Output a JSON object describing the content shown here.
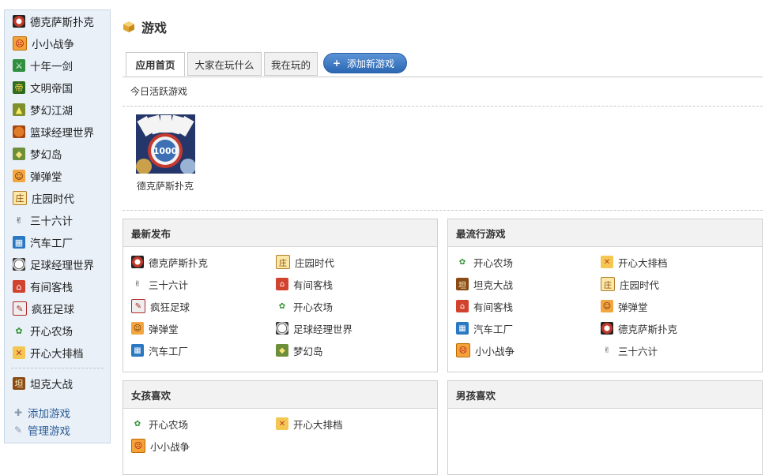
{
  "header": {
    "title": "游戏"
  },
  "sidebar": {
    "items": [
      {
        "label": "德克萨斯扑克",
        "icon": "poker-chip-icon",
        "cls": "i-poker",
        "glyph": ""
      },
      {
        "label": "小小战争",
        "icon": "little-war-icon",
        "cls": "i-war",
        "glyph": "☹"
      },
      {
        "label": "十年一剑",
        "icon": "sword-icon",
        "cls": "i-sword",
        "glyph": "⚔"
      },
      {
        "label": "文明帝国",
        "icon": "empire-icon",
        "cls": "i-empire",
        "glyph": "帝"
      },
      {
        "label": "梦幻江湖",
        "icon": "dream-jianghu-icon",
        "cls": "i-dream",
        "glyph": "▲"
      },
      {
        "label": "篮球经理世界",
        "icon": "basketball-icon",
        "cls": "i-basket",
        "glyph": ""
      },
      {
        "label": "梦幻岛",
        "icon": "island-icon",
        "cls": "i-island",
        "glyph": "◆"
      },
      {
        "label": "弹弹堂",
        "icon": "bomb-face-icon",
        "cls": "i-bomb",
        "glyph": "☺"
      },
      {
        "label": "庄园时代",
        "icon": "farmhouse-icon",
        "cls": "i-farmhouse",
        "glyph": "庄"
      },
      {
        "label": "三十六计",
        "icon": "thirty-six-strategies-icon",
        "cls": "i-36",
        "glyph": "✌"
      },
      {
        "label": "汽车工厂",
        "icon": "car-factory-icon",
        "cls": "i-car",
        "glyph": "▦"
      },
      {
        "label": "足球经理世界",
        "icon": "soccer-ball-icon",
        "cls": "i-soccer",
        "glyph": ""
      },
      {
        "label": "有间客栈",
        "icon": "inn-icon",
        "cls": "i-inn",
        "glyph": "⌂"
      },
      {
        "label": "疯狂足球",
        "icon": "crazy-football-icon",
        "cls": "i-crazy",
        "glyph": "✎"
      },
      {
        "label": "开心农场",
        "icon": "sprout-icon",
        "cls": "i-farm",
        "glyph": "✿"
      },
      {
        "label": "开心大排档",
        "icon": "food-stall-icon",
        "cls": "i-rank",
        "glyph": "✕"
      }
    ],
    "extra_item": {
      "label": "坦克大战",
      "icon": "tank-battle-icon",
      "cls": "i-tank",
      "glyph": "坦"
    },
    "links": [
      {
        "label": "添加游戏",
        "icon": "plus-icon",
        "glyph": "✚"
      },
      {
        "label": "管理游戏",
        "icon": "wrench-icon",
        "glyph": "✎"
      }
    ]
  },
  "tabs": [
    {
      "label": "应用首页",
      "active": true
    },
    {
      "label": "大家在玩什么",
      "active": false
    },
    {
      "label": "我在玩的",
      "active": false
    }
  ],
  "add_button": {
    "label": "添加新游戏"
  },
  "today": {
    "label": "今日活跃游戏",
    "featured": {
      "name": "德克萨斯扑克",
      "chip_text": "1000"
    }
  },
  "panels": {
    "latest": {
      "title": "最新发布",
      "items": [
        {
          "label": "德克萨斯扑克",
          "icon": "poker-chip-icon",
          "cls": "i-poker",
          "glyph": ""
        },
        {
          "label": "庄园时代",
          "icon": "farmhouse-icon",
          "cls": "i-farmhouse",
          "glyph": "庄"
        },
        {
          "label": "三十六计",
          "icon": "thirty-six-strategies-icon",
          "cls": "i-36",
          "glyph": "✌"
        },
        {
          "label": "有间客栈",
          "icon": "inn-icon",
          "cls": "i-inn",
          "glyph": "⌂"
        },
        {
          "label": "疯狂足球",
          "icon": "crazy-football-icon",
          "cls": "i-crazy",
          "glyph": "✎"
        },
        {
          "label": "开心农场",
          "icon": "sprout-icon",
          "cls": "i-farm",
          "glyph": "✿"
        },
        {
          "label": "弹弹堂",
          "icon": "bomb-face-icon",
          "cls": "i-bomb",
          "glyph": "☺"
        },
        {
          "label": "足球经理世界",
          "icon": "soccer-ball-icon",
          "cls": "i-soccer",
          "glyph": ""
        },
        {
          "label": "汽车工厂",
          "icon": "car-factory-icon",
          "cls": "i-car",
          "glyph": "▦"
        },
        {
          "label": "梦幻岛",
          "icon": "island-icon",
          "cls": "i-island",
          "glyph": "◆"
        }
      ]
    },
    "popular": {
      "title": "最流行游戏",
      "items": [
        {
          "label": "开心农场",
          "icon": "sprout-icon",
          "cls": "i-farm",
          "glyph": "✿"
        },
        {
          "label": "开心大排档",
          "icon": "food-stall-icon",
          "cls": "i-rank",
          "glyph": "✕"
        },
        {
          "label": "坦克大战",
          "icon": "tank-battle-icon",
          "cls": "i-tank",
          "glyph": "坦"
        },
        {
          "label": "庄园时代",
          "icon": "farmhouse-icon",
          "cls": "i-farmhouse",
          "glyph": "庄"
        },
        {
          "label": "有间客栈",
          "icon": "inn-icon",
          "cls": "i-inn",
          "glyph": "⌂"
        },
        {
          "label": "弹弹堂",
          "icon": "bomb-face-icon",
          "cls": "i-bomb",
          "glyph": "☺"
        },
        {
          "label": "汽车工厂",
          "icon": "car-factory-icon",
          "cls": "i-car",
          "glyph": "▦"
        },
        {
          "label": "德克萨斯扑克",
          "icon": "poker-chip-icon",
          "cls": "i-poker",
          "glyph": ""
        },
        {
          "label": "小小战争",
          "icon": "little-war-icon",
          "cls": "i-war",
          "glyph": "☹"
        },
        {
          "label": "三十六计",
          "icon": "thirty-six-strategies-icon",
          "cls": "i-36",
          "glyph": "✌"
        }
      ]
    },
    "girls": {
      "title": "女孩喜欢",
      "items": [
        {
          "label": "开心农场",
          "icon": "sprout-icon",
          "cls": "i-farm",
          "glyph": "✿"
        },
        {
          "label": "开心大排档",
          "icon": "food-stall-icon",
          "cls": "i-rank",
          "glyph": "✕"
        },
        {
          "label": "小小战争",
          "icon": "little-war-icon",
          "cls": "i-war",
          "glyph": "☹"
        }
      ]
    },
    "boys": {
      "title": "男孩喜欢",
      "items": []
    }
  },
  "colors": {
    "accent": "#2c68b4",
    "link": "#2f5f98",
    "sidebar_bg": "#e9f0f8"
  }
}
